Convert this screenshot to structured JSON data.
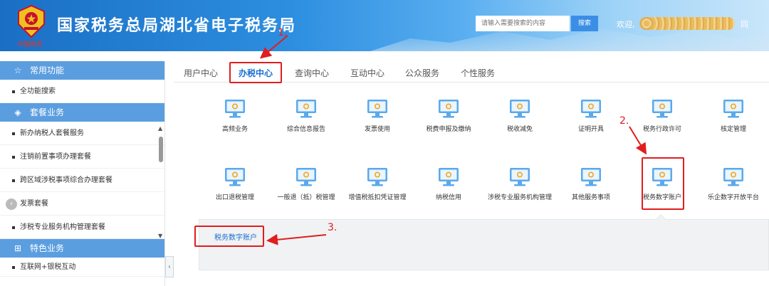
{
  "header": {
    "title": "国家税务总局湖北省电子税务局",
    "logo_subtitle": "中国税务",
    "search_placeholder": "请输入需要搜索的内容",
    "search_button": "搜索",
    "welcome": "欢迎,",
    "user_tail": "同"
  },
  "sidebar": {
    "sections": [
      {
        "label": "常用功能",
        "icon": "star-icon"
      },
      {
        "label": "套餐业务",
        "icon": "layers-icon"
      },
      {
        "label": "特色业务",
        "icon": "grid-icon"
      }
    ],
    "common_items": [
      "全功能搜索"
    ],
    "package_items": [
      "新办纳税人套餐服务",
      "注销前置事项办理套餐",
      "跨区域涉税事项综合办理套餐",
      "发票套餐",
      "涉税专业服务机构管理套餐"
    ],
    "special_items": [
      "互联网+银税互动"
    ]
  },
  "tabs": [
    {
      "label": "用户中心"
    },
    {
      "label": "办税中心",
      "active": true
    },
    {
      "label": "查询中心"
    },
    {
      "label": "互动中心"
    },
    {
      "label": "公众服务"
    },
    {
      "label": "个性服务"
    }
  ],
  "tiles_row1": [
    "高频业务",
    "综合信息报告",
    "发票使用",
    "税费申报及缴纳",
    "税收减免",
    "证明开具",
    "税务行政许可",
    "核定管理"
  ],
  "tiles_row2": [
    "出口退税管理",
    "一般退（抵）税管理",
    "增值税抵扣凭证管理",
    "纳税信用",
    "涉税专业服务机构管理",
    "其他服务事项",
    "税务数字账户",
    "乐企数字开放平台"
  ],
  "sub_link": "税务数字账户",
  "annotations": [
    "1.",
    "2.",
    "3."
  ],
  "colors": {
    "accent": "#1a6fd0",
    "highlight": "#e01e1e",
    "sidebar_section": "#5b9ee0"
  }
}
